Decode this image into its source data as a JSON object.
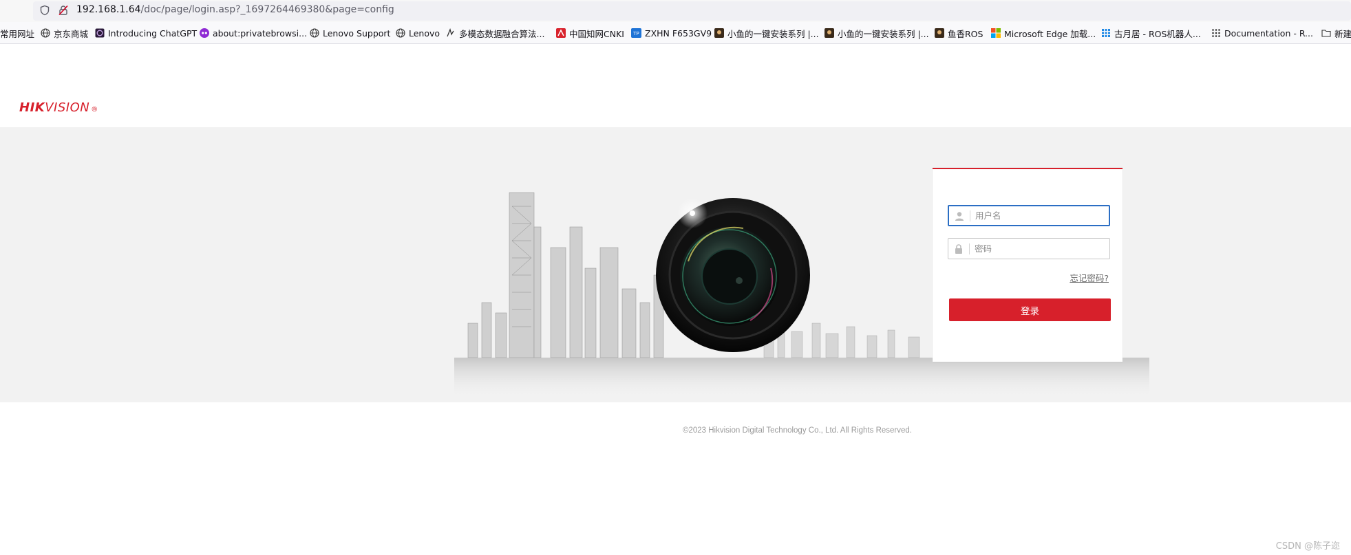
{
  "browser": {
    "url_host": "192.168.1.64",
    "url_rest": "/doc/page/login.asp?_1697264469380&page=config",
    "bookmarks": [
      {
        "label": "常用网址",
        "icon": "none"
      },
      {
        "label": "京东商城",
        "icon": "globe-icon"
      },
      {
        "label": "Introducing ChatGPT",
        "icon": "chatgpt-icon"
      },
      {
        "label": "about:privatebrowsi...",
        "icon": "private-icon"
      },
      {
        "label": "Lenovo Support",
        "icon": "globe-icon"
      },
      {
        "label": "Lenovo",
        "icon": "globe-icon"
      },
      {
        "label": "多模态数据融合算法...",
        "icon": "script-icon"
      },
      {
        "label": "中国知网CNKI",
        "icon": "cnki-icon"
      },
      {
        "label": "ZXHN F653GV9",
        "icon": "zte-icon"
      },
      {
        "label": "小鱼的一键安装系列 |...",
        "icon": "avatar-icon"
      },
      {
        "label": "小鱼的一键安装系列 |...",
        "icon": "avatar-icon"
      },
      {
        "label": "鱼香ROS",
        "icon": "avatar-icon"
      },
      {
        "label": "Microsoft Edge 加载...",
        "icon": "microsoft-icon"
      },
      {
        "label": "古月居 - ROS机器人...",
        "icon": "grid-icon"
      },
      {
        "label": "Documentation - R...",
        "icon": "dots-icon"
      },
      {
        "label": "新建",
        "icon": "folder-icon"
      }
    ]
  },
  "brand": {
    "logo_hik": "HIK",
    "logo_vision": "VISION",
    "logo_reg": "®",
    "color": "#d7202b"
  },
  "login": {
    "username_placeholder": "用户名",
    "password_placeholder": "密码",
    "forgot_label": "忘记密码?",
    "submit_label": "登录"
  },
  "footer": {
    "copyright": "©2023 Hikvision Digital Technology Co., Ltd. All Rights Reserved.",
    "watermark": "CSDN @陈子迩"
  }
}
